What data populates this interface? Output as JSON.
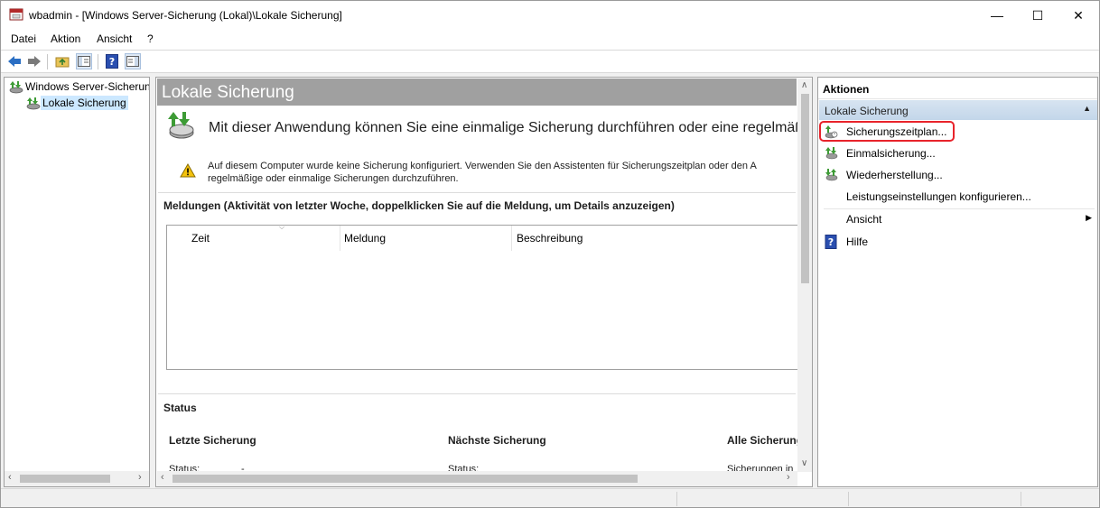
{
  "window": {
    "title": "wbadmin - [Windows Server-Sicherung (Lokal)\\Lokale Sicherung]",
    "minimize": "—",
    "maximize": "☐",
    "close": "✕"
  },
  "menu": [
    "Datei",
    "Aktion",
    "Ansicht",
    "?"
  ],
  "toolbar": {
    "icons": [
      "back-arrow-icon",
      "forward-arrow-icon",
      "folder-up-icon",
      "console-tree-icon",
      "help-icon",
      "show-hide-pane-icon"
    ]
  },
  "tree": {
    "items": [
      {
        "label": "Windows Server-Sicherun",
        "icon": "backup-icon"
      },
      {
        "label": "Lokale Sicherung",
        "icon": "backup-icon",
        "selected": true
      }
    ]
  },
  "center": {
    "title": "Lokale Sicherung",
    "intro": "Mit dieser Anwendung können Sie eine einmalige Sicherung durchführen oder eine regelmäßig",
    "warning_line1": "Auf diesem Computer wurde keine Sicherung konfiguriert. Verwenden Sie den Assistenten für Sicherungszeitplan oder den A",
    "warning_line2": "regelmäßige oder einmalige Sicherungen durchzuführen.",
    "messages_title": "Meldungen (Aktivität von letzter Woche, doppelklicken Sie auf die Meldung, um Details anzuzeigen)",
    "columns": [
      "Zeit",
      "Meldung",
      "Beschreibung"
    ],
    "status_title": "Status",
    "status": {
      "last": {
        "heading": "Letzte Sicherung",
        "label": "Status:",
        "value": "-"
      },
      "next": {
        "heading": "Nächste Sicherung",
        "label": "Status:",
        "value": ""
      },
      "all": {
        "heading": "Alle Sicherung",
        "label": "Sicherungen in",
        "value": ""
      }
    }
  },
  "actions": {
    "title": "Aktionen",
    "group": "Lokale Sicherung",
    "items": [
      {
        "label": "Sicherungszeitplan...",
        "icon": "backup-schedule-icon"
      },
      {
        "label": "Einmalsicherung...",
        "icon": "backup-once-icon"
      },
      {
        "label": "Wiederherstellung...",
        "icon": "recover-icon"
      },
      {
        "label": "Leistungseinstellungen konfigurieren...",
        "icon": ""
      },
      {
        "label": "Ansicht",
        "icon": ""
      },
      {
        "label": "Hilfe",
        "icon": "help-icon"
      }
    ]
  },
  "colors": {
    "center_header_bg": "#a0a0a0",
    "selection_bg": "#cce8ff",
    "group_bar": "#c9dbed",
    "highlight_box": "#e8232b",
    "help_icon": "#2a4fb0"
  }
}
